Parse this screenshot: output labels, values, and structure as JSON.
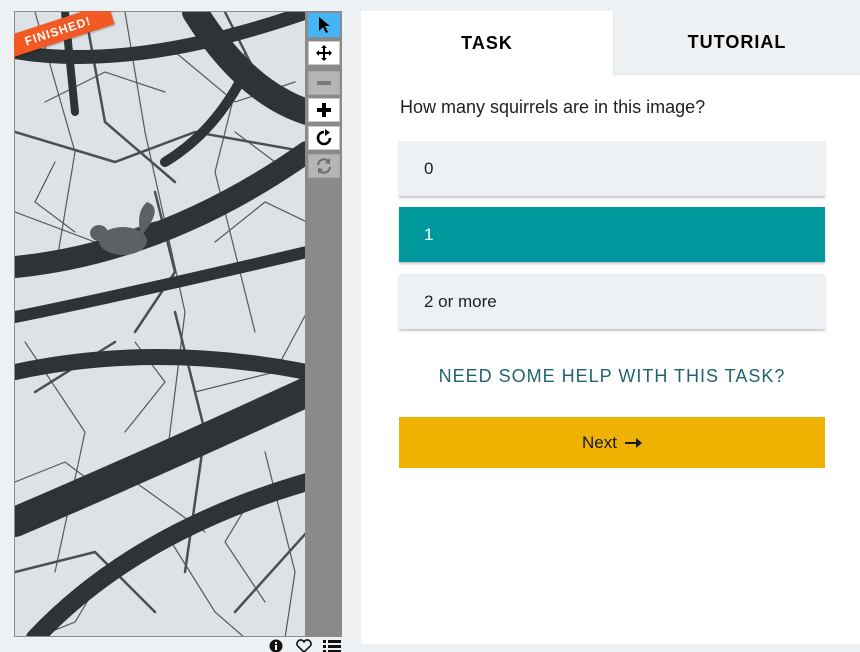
{
  "viewer": {
    "status_banner": "FINISHED!",
    "tools": [
      {
        "name": "pointer-icon",
        "state": "active"
      },
      {
        "name": "move-icon",
        "state": "normal"
      },
      {
        "name": "zoom-out-icon",
        "state": "disabled"
      },
      {
        "name": "zoom-in-icon",
        "state": "normal"
      },
      {
        "name": "rotate-icon",
        "state": "normal"
      },
      {
        "name": "reset-icon",
        "state": "disabled"
      }
    ],
    "meta_icons": [
      "info-icon",
      "heart-icon",
      "list-icon"
    ]
  },
  "task_panel": {
    "tabs": [
      {
        "label": "TASK",
        "active": true
      },
      {
        "label": "TUTORIAL",
        "active": false
      }
    ],
    "question": "How many squirrels are in this image?",
    "answers": [
      {
        "label": "0",
        "selected": false
      },
      {
        "label": "1",
        "selected": true
      },
      {
        "label": "2 or more",
        "selected": false
      }
    ],
    "help_label": "NEED SOME HELP WITH THIS TASK?",
    "next_label": "Next"
  },
  "colors": {
    "selected_answer": "#00979d",
    "next_button": "#f0b200",
    "banner": "#f15a24",
    "active_tool": "#45b4f5",
    "help_text": "#1f6470"
  }
}
